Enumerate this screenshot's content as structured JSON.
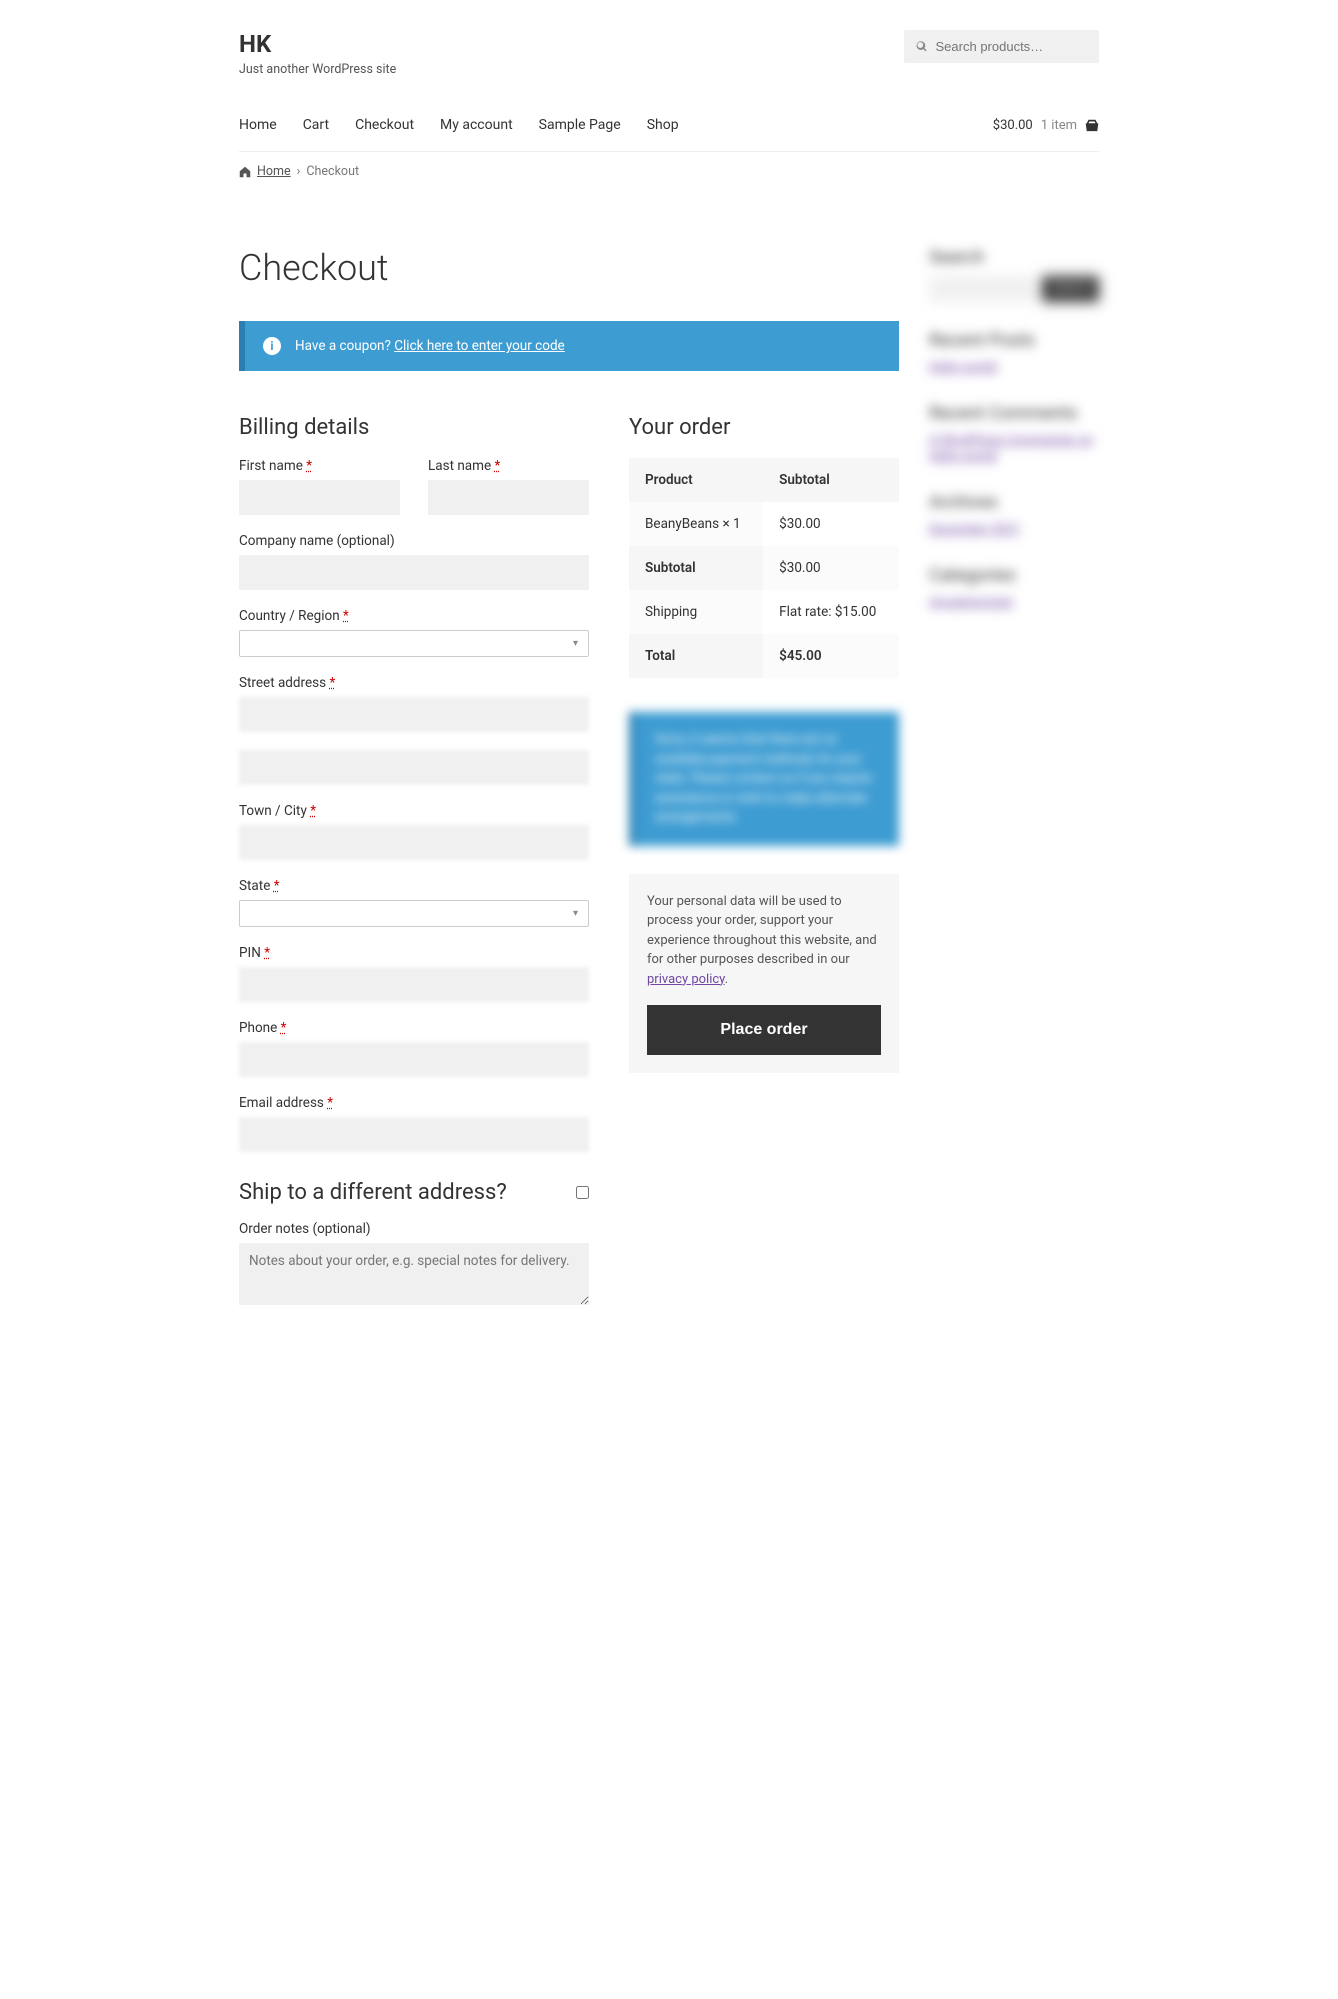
{
  "site": {
    "title": "HK",
    "tagline": "Just another WordPress site"
  },
  "search": {
    "placeholder": "Search products…"
  },
  "nav": {
    "items": [
      "Home",
      "Cart",
      "Checkout",
      "My account",
      "Sample Page",
      "Shop"
    ],
    "cart_amount": "$30.00",
    "cart_count": "1 item"
  },
  "breadcrumb": {
    "home": "Home",
    "current": "Checkout"
  },
  "page": {
    "title": "Checkout"
  },
  "coupon": {
    "text": "Have a coupon?",
    "link": "Click here to enter your code"
  },
  "billing": {
    "title": "Billing details",
    "first_name_label": "First name",
    "first_name_val": "",
    "last_name_label": "Last name",
    "last_name_val": "",
    "company_label": "Company name (optional)",
    "company_val": "",
    "country_label": "Country / Region",
    "country_val": "",
    "street_label": "Street address",
    "street1_val": "",
    "street2_val": "",
    "city_label": "Town / City",
    "city_val": "",
    "state_label": "State",
    "state_val": "",
    "pin_label": "PIN",
    "pin_val": "",
    "phone_label": "Phone",
    "phone_val": "",
    "email_label": "Email address",
    "email_val": ""
  },
  "ship": {
    "title": "Ship to a different address?",
    "notes_label": "Order notes (optional)",
    "notes_placeholder": "Notes about your order, e.g. special notes for delivery."
  },
  "order": {
    "title": "Your order",
    "th_product": "Product",
    "th_subtotal": "Subtotal",
    "item_name": "BeanyBeans × 1",
    "item_price": "$30.00",
    "sub_label": "Subtotal",
    "sub_val": "$30.00",
    "ship_label": "Shipping",
    "ship_val": "Flat rate: $15.00",
    "total_label": "Total",
    "total_val": "$45.00"
  },
  "payment_notice": "Sorry, it seems that there are no available payment methods for your state. Please contact us if you require assistance or wish to make alternate arrangements.",
  "privacy": {
    "text": "Your personal data will be used to process your order, support your experience throughout this website, and for other purposes described in our ",
    "link": "privacy policy"
  },
  "place_order": "Place order",
  "sidebar": {
    "search_title": "Search",
    "search_btn": "Search",
    "recent_posts": "Recent Posts",
    "recent_posts_link": "Hello world!",
    "recent_comments": "Recent Comments",
    "recent_comments_link": "A WordPress Commenter on Hello world!",
    "archives": "Archives",
    "archives_link": "December 2021",
    "categories": "Categories",
    "categories_link": "Uncategorized"
  }
}
